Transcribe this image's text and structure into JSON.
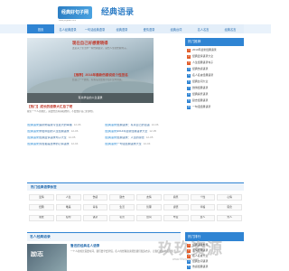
{
  "header": {
    "logo_text": "经典好句子网",
    "logo_sub": "www.jingdian.com",
    "site_title": "经典语录"
  },
  "nav": {
    "items": [
      {
        "label": "首页",
        "active": true
      },
      {
        "label": "名人经典语录",
        "active": false
      },
      {
        "label": "一句话经典语录",
        "active": false
      },
      {
        "label": "经典语录",
        "active": false
      },
      {
        "label": "爱情语录",
        "active": false
      },
      {
        "label": "经典台词",
        "active": false
      },
      {
        "label": "名人名言",
        "active": false
      },
      {
        "label": "经典名言",
        "active": false
      }
    ]
  },
  "hero": {
    "caption": "有关学业的人生语录"
  },
  "center": {
    "block1_title": "现在自己好想要晓得",
    "block1_text": "这是关于生活中一些经典语录，感悟人生的经典句子。",
    "block2_title": "【推荐】2014年最新伤感说说个性签名",
    "block2_text": "给自己一个微笑，有些东西会在不知不觉中消失。",
    "block3_title": "【热门】成长的语录大汇总了吧",
    "block3_text": "我们一个人的成长，需要经历风雨和挫折，不要放弃自己的梦想。"
  },
  "list": {
    "rows": [
      {
        "tag": "[经典语录]",
        "title": "遇到你是我今生最大的幸福",
        "date": "12-06"
      },
      {
        "tag": "[经典语录]",
        "title": "经典语录：有关自己的话语",
        "date": "12-06"
      },
      {
        "tag": "[经典语录]",
        "title": "你会明白的人生经典语录",
        "date": "12-06"
      },
      {
        "tag": "[经典语录]",
        "title": "2014年最新经典语录大全",
        "date": "12-05"
      },
      {
        "tag": "[经典语录]",
        "title": "经典爱情语录句子大全",
        "date": "12-05"
      },
      {
        "tag": "[经典语录]",
        "title": "经典语录：人生的感悟",
        "date": "12-05"
      },
      {
        "tag": "[经典语录]",
        "title": "现在都是这样的心情语录",
        "date": "12-04"
      },
      {
        "tag": "[经典语录]",
        "title": "一句话经典语录大全",
        "date": "12-04"
      }
    ]
  },
  "sidebar": {
    "title": "热门推荐",
    "items": [
      "2014年最新经典语录",
      "经典爱情语录大全",
      "人生经典语录句子",
      "经典伤感语录",
      "名人名言经典语录",
      "经典台词大全",
      "微博经典语录",
      "经典搞笑语录",
      "励志经典语录",
      "一句话经典语录"
    ]
  },
  "tags": {
    "title": "热门经典语录标签",
    "items": [
      "爱情",
      "人生",
      "伤感",
      "励志",
      "友情",
      "搞笑",
      "个性",
      "心情",
      "经典",
      "唯美",
      "青春",
      "生活",
      "哲理",
      "感悟",
      "幸福",
      "思念",
      "朋友",
      "短句",
      "语录",
      "名言",
      "台词",
      "毕业",
      "女人",
      "男人"
    ]
  },
  "famous": {
    "title": "名人经典语录",
    "image_text": "励志",
    "article_title": "鲁迅的经典名人语录",
    "article_text": "一个人的成长需要时间，我们要学会珍惜。名人的经典语录能给我们很多启示，让我们更好地面对生活。"
  },
  "sidebar2": {
    "title": "热门排行",
    "items": [
      "经典语录推荐",
      "爱情经典语录",
      "名人名言大全",
      "经典台词语录",
      "伤感经典语录"
    ]
  },
  "watermark": {
    "text": "玖玖资源",
    "url": "www.99ziyuan.com"
  }
}
